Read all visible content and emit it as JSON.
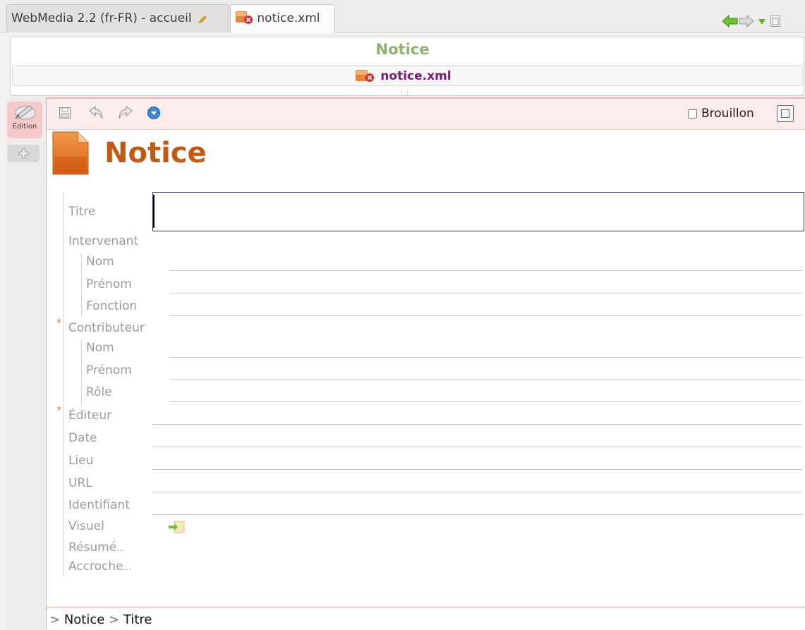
{
  "tabs": [
    {
      "label": "WebMedia 2.2 (fr-FR) - accueil"
    },
    {
      "label": "notice.xml"
    }
  ],
  "header": {
    "title": "Notice",
    "file": "notice.xml"
  },
  "sidebar": {
    "edition_label": "Édition"
  },
  "toolbar": {
    "brouillon_label": "Brouillon"
  },
  "document": {
    "title": "Notice"
  },
  "form": {
    "titre": "Titre",
    "intervenant": "Intervenant",
    "intervenant_nom": "Nom",
    "intervenant_prenom": "Prénom",
    "intervenant_fonction": "Fonction",
    "contributeur": "Contributeur",
    "contributeur_nom": "Nom",
    "contributeur_prenom": "Prénom",
    "contributeur_role": "Rôle",
    "editeur": "Éditeur",
    "date": "Date",
    "lieu": "Lieu",
    "url": "URL",
    "identifiant": "Identifiant",
    "visuel": "Visuel",
    "resume": "Résumé",
    "accroche": "Accroche",
    "required_marker": "*",
    "more_marker": "..."
  },
  "breadcrumb": {
    "sep": ">",
    "item1": "Notice",
    "item2": "Titre"
  },
  "colors": {
    "header_title": "#8cb36b",
    "doc_title": "#c35a14",
    "file_link": "#7b1a7b",
    "accent_border": "#e5a3a3"
  }
}
